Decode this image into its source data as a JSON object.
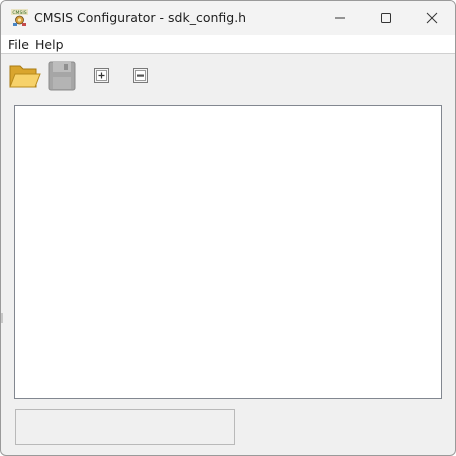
{
  "window": {
    "title": "CMSIS Configurator - sdk_config.h",
    "app_icon_text": "CMSIS"
  },
  "menu": {
    "items": [
      {
        "label": "File"
      },
      {
        "label": "Help"
      }
    ]
  },
  "toolbar": {
    "buttons": [
      {
        "icon": "folder-open-icon",
        "enabled": true
      },
      {
        "icon": "floppy-disk-icon",
        "enabled": false
      },
      {
        "icon": "expand-all-icon",
        "enabled": true
      },
      {
        "icon": "collapse-all-icon",
        "enabled": true
      }
    ]
  },
  "colors": {
    "titlebar": "#f3f3f3",
    "window_bg": "#f0f0f0",
    "panel_bg": "#ffffff",
    "folder_yellow": "#f4c542",
    "disabled_gray": "#a6a6a6"
  }
}
